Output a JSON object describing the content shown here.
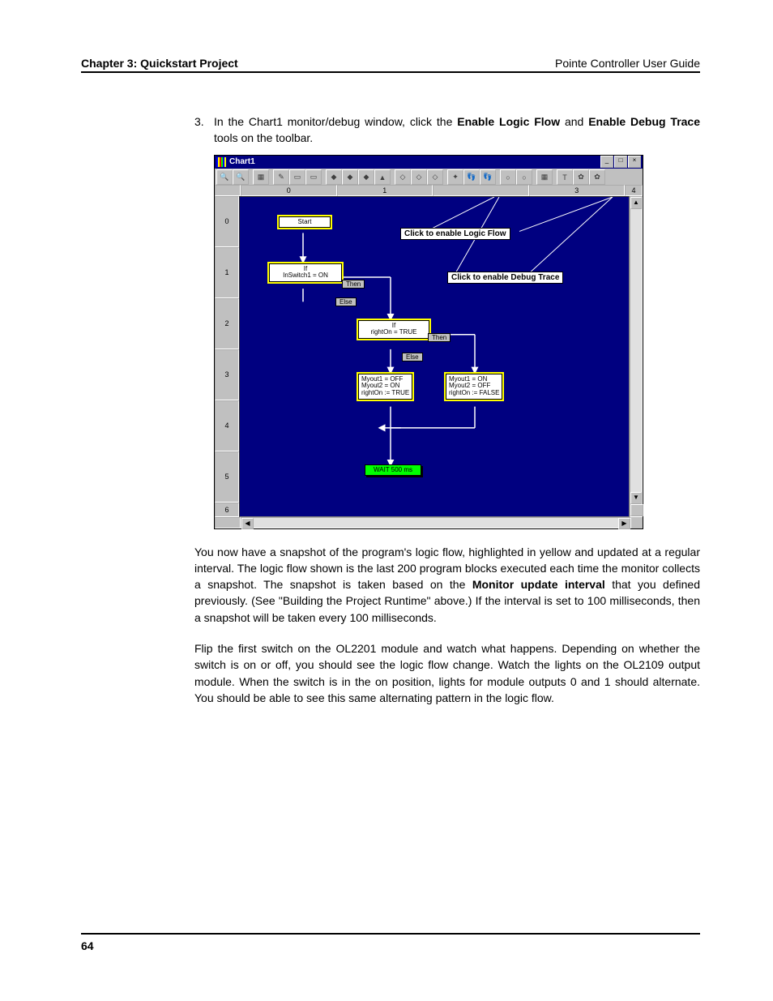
{
  "header": {
    "chapter": "Chapter 3: Quickstart Project",
    "guide": "Pointe Controller User Guide"
  },
  "step3": {
    "num": "3.",
    "text_pre": "In the Chart1 monitor/debug window, click the ",
    "bold1": "Enable Logic Flow",
    "text_mid": " and ",
    "bold2": "Enable Debug Trace",
    "text_post": " tools on the toolbar."
  },
  "app": {
    "title": "Chart1",
    "col_labels": [
      "0",
      "1",
      "",
      "3",
      "4"
    ],
    "row_labels": [
      "0",
      "1",
      "2",
      "3",
      "4",
      "5",
      "6"
    ],
    "callouts": {
      "logic_flow": "Click to enable Logic Flow",
      "debug_trace": "Click to enable Debug Trace"
    },
    "blocks": {
      "start": "Start",
      "if1": "If\nInSwitch1 =   ON",
      "if2": "If\nrightOn =  TRUE",
      "left_assign": "Myout1  =  OFF\nMyout2  =  ON\nrightOn  :=  TRUE",
      "right_assign": "Myout1  =  ON\nMyout2  =  OFF\nrightOn  :=  FALSE",
      "wait": "WAIT 500 ms",
      "then": "Then",
      "else": "Else"
    }
  },
  "para1": {
    "pre": "You now have a snapshot of the program's logic flow, highlighted in yellow and updated at a regular interval. The logic flow shown is the last 200 program blocks executed each time the monitor collects a snapshot. The snapshot is taken based on the ",
    "bold": "Monitor update interval",
    "post": " that you defined previously. (See \"Building the Project Runtime\" above.) If the interval is set to 100 milliseconds, then a snapshot will be taken every 100 milliseconds."
  },
  "para2": "Flip the first switch on the OL2201 module and watch what happens. Depending on whether the switch is on or off, you should see the logic flow change. Watch the lights on the OL2109 output module. When the switch is in the on position, lights for module outputs 0 and 1 should alternate. You should be able to see this same alternating pattern in the logic flow.",
  "page_number": "64"
}
